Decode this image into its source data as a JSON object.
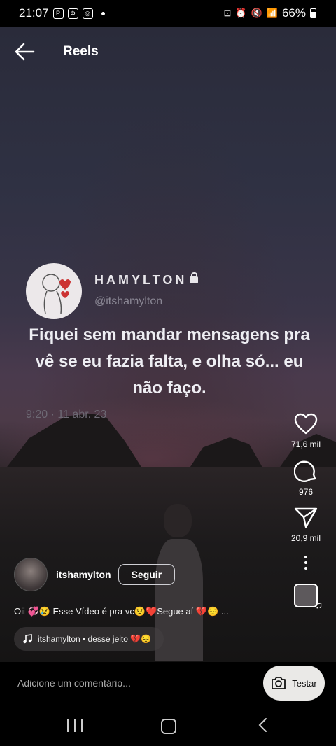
{
  "statusbar": {
    "time": "21:07",
    "battery": "66%"
  },
  "header": {
    "title": "Reels"
  },
  "post": {
    "name": "HAMYLTON",
    "handle": "@itshamylton",
    "text": "Fiquei sem mandar mensagens pra vê se eu fazia falta, e olha só... eu não faço.",
    "date": "9:20 · 11 abr. 23"
  },
  "actions": {
    "likes": "71,6 mil",
    "comments": "976",
    "shares": "20,9 mil"
  },
  "author": {
    "username": "itshamylton",
    "follow_label": "Seguir"
  },
  "caption": "Oii 💞😢 Esse Vídeo é pra vc😣❤️Segue aí 💔😔 ...",
  "audio": {
    "label": "itshamylton • desse jeito 💔😔"
  },
  "comment": {
    "placeholder": "Adicione um comentário...",
    "try_label": "Testar"
  }
}
